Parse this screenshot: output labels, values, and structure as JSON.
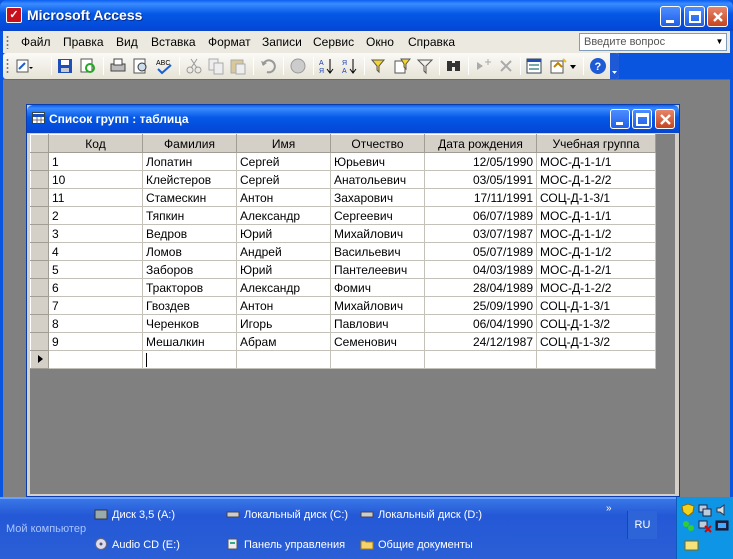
{
  "app": {
    "title": "Microsoft Access",
    "menu": [
      "Файл",
      "Правка",
      "Вид",
      "Вставка",
      "Формат",
      "Записи",
      "Сервис",
      "Окно",
      "Справка"
    ],
    "help_placeholder": "Введите вопрос"
  },
  "toolbar": {
    "buttons": [
      "view-icon",
      "save-icon",
      "search-doc-icon",
      "print-icon",
      "print-preview-icon",
      "spelling-icon",
      "cut-icon",
      "copy-icon",
      "paste-icon",
      "undo-icon",
      "hyperlink-icon",
      "sort-ascending-icon",
      "sort-descending-icon",
      "filter-by-selection-icon",
      "filter-by-form-icon",
      "apply-filter-icon",
      "find-icon",
      "new-record-icon",
      "delete-record-icon",
      "database-window-icon",
      "new-object-icon",
      "help-icon"
    ]
  },
  "datasheet": {
    "title": "Список групп : таблица",
    "columns": [
      "Код",
      "Фамилия",
      "Имя",
      "Отчество",
      "Дата рождения",
      "Учебная группа"
    ],
    "rows": [
      [
        "1",
        "Лопатин",
        "Сергей",
        "Юрьевич",
        "12/05/1990",
        "МОС-Д-1-1/1"
      ],
      [
        "10",
        "Клейстеров",
        "Сергей",
        "Анатольевич",
        "03/05/1991",
        "МОС-Д-1-2/2"
      ],
      [
        "11",
        "Стамескин",
        "Антон",
        "Захарович",
        "17/11/1991",
        "СОЦ-Д-1-3/1"
      ],
      [
        "2",
        "Тяпкин",
        "Александр",
        "Сергеевич",
        "06/07/1989",
        "МОС-Д-1-1/1"
      ],
      [
        "3",
        "Ведров",
        "Юрий",
        "Михайлович",
        "03/07/1987",
        "МОС-Д-1-1/2"
      ],
      [
        "4",
        "Ломов",
        "Андрей",
        "Васильевич",
        "05/07/1989",
        "МОС-Д-1-1/2"
      ],
      [
        "5",
        "Заборов",
        "Юрий",
        "Пантелеевич",
        "04/03/1989",
        "МОС-Д-1-2/1"
      ],
      [
        "6",
        "Тракторов",
        "Александр",
        "Фомич",
        "28/04/1989",
        "МОС-Д-1-2/2"
      ],
      [
        "7",
        "Гвоздев",
        "Антон",
        "Михайлович",
        "25/09/1990",
        "СОЦ-Д-1-3/1"
      ],
      [
        "8",
        "Черенков",
        "Игорь",
        "Павлович",
        "06/04/1990",
        "СОЦ-Д-1-3/2"
      ],
      [
        "9",
        "Мешалкин",
        "Абрам",
        "Семенович",
        "24/12/1987",
        "СОЦ-Д-1-3/2"
      ]
    ]
  },
  "taskbar": {
    "my_computer": "Мой компьютер",
    "links": [
      "Диск 3,5 (A:)",
      "Локальный диск (C:)",
      "Локальный диск (D:)",
      "Audio CD (E:)",
      "Панель управления",
      "Общие документы"
    ],
    "chevron": "»",
    "lang": "RU"
  }
}
